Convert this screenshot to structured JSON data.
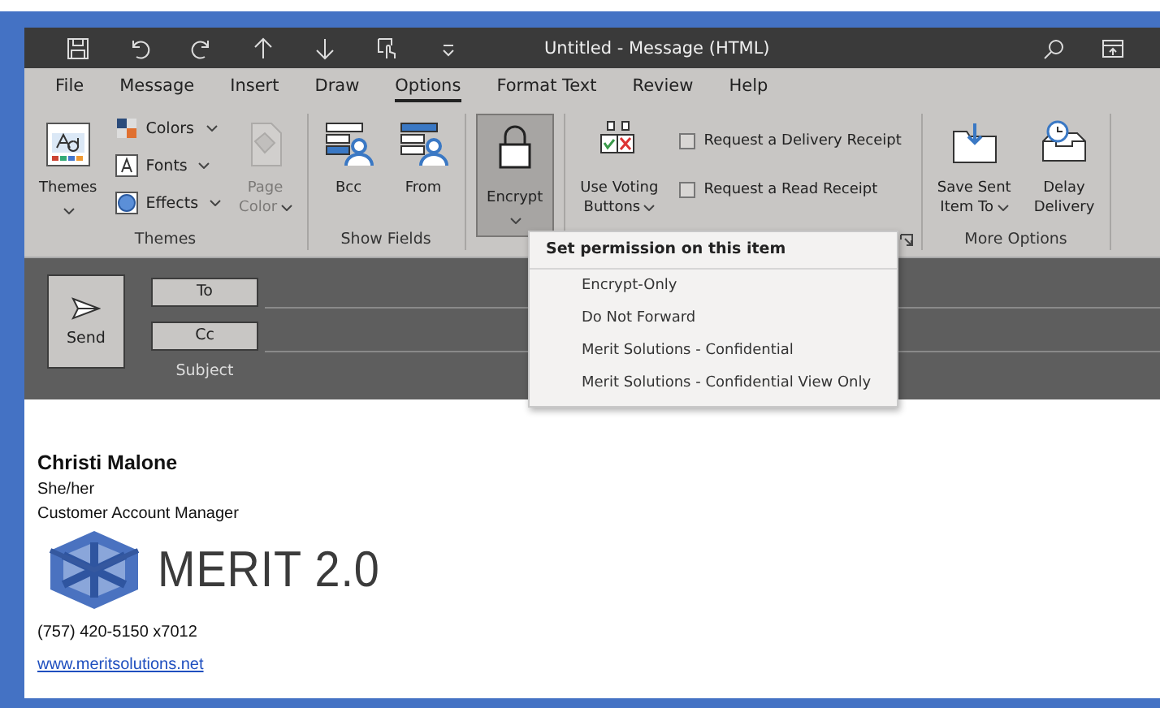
{
  "window": {
    "title": "Untitled - Message (HTML)"
  },
  "tabs": [
    {
      "label": "File",
      "selected": false
    },
    {
      "label": "Message",
      "selected": false
    },
    {
      "label": "Insert",
      "selected": false
    },
    {
      "label": "Draw",
      "selected": false
    },
    {
      "label": "Options",
      "selected": true
    },
    {
      "label": "Format Text",
      "selected": false
    },
    {
      "label": "Review",
      "selected": false
    },
    {
      "label": "Help",
      "selected": false
    }
  ],
  "ribbon": {
    "groups": [
      {
        "label": "Themes",
        "launcher": false,
        "items": [
          {
            "kind": "large",
            "lines": [
              "Themes"
            ],
            "caret": true,
            "disabled": false,
            "pressed": false
          },
          {
            "kind": "stack",
            "entries": [
              {
                "label": "Colors",
                "caret": true
              },
              {
                "label": "Fonts",
                "caret": true
              },
              {
                "label": "Effects",
                "caret": true
              }
            ]
          },
          {
            "kind": "large",
            "lines": [
              "Page",
              "Color"
            ],
            "caret": true,
            "disabled": true,
            "pressed": false
          }
        ]
      },
      {
        "label": "Show Fields",
        "launcher": false,
        "items": [
          {
            "kind": "large",
            "lines": [
              "Bcc"
            ],
            "caret": false,
            "disabled": false,
            "pressed": false
          },
          {
            "kind": "large",
            "lines": [
              "From"
            ],
            "caret": false,
            "disabled": false,
            "pressed": false
          }
        ]
      },
      {
        "items": [
          {
            "kind": "large",
            "lines": [
              "Encrypt"
            ],
            "caret": true,
            "disabled": false,
            "pressed": true
          }
        ],
        "launcher": false
      },
      {
        "launcher": true,
        "items": [
          {
            "kind": "large",
            "lines": [
              "Use Voting",
              "Buttons"
            ],
            "caret": true,
            "disabled": false,
            "pressed": false
          },
          {
            "kind": "checks",
            "entries": [
              {
                "label": "Request a Delivery Receipt",
                "checked": false
              },
              {
                "label": "Request a Read Receipt",
                "checked": false
              }
            ]
          }
        ]
      },
      {
        "label": "More Options",
        "launcher": false,
        "items": [
          {
            "kind": "large",
            "lines": [
              "Save Sent",
              "Item To"
            ],
            "caret": true,
            "disabled": false,
            "pressed": false
          },
          {
            "kind": "large",
            "lines": [
              "Delay",
              "Delivery"
            ],
            "caret": false,
            "disabled": false,
            "pressed": false
          }
        ]
      }
    ]
  },
  "encrypt_menu": {
    "header": "Set permission on this item",
    "items": [
      "Encrypt-Only",
      "Do Not Forward",
      "Merit Solutions - Confidential",
      "Merit Solutions - Confidential View Only"
    ]
  },
  "compose": {
    "send": "Send",
    "fields": [
      "To",
      "Cc"
    ],
    "subject": "Subject"
  },
  "signature": {
    "name": "Christi Malone",
    "pronouns": "She/her",
    "job_title": "Customer Account Manager",
    "logo_text": "MERIT 2.0",
    "phone": "(757) 420-5150 x7012",
    "link": "www.meritsolutions.net"
  }
}
